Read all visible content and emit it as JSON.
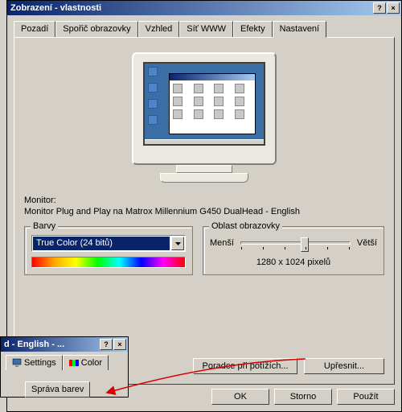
{
  "mainWindow": {
    "title": "Zobrazení - vlastnosti",
    "helpBtn": "?",
    "closeBtn": "×"
  },
  "tabs": [
    "Pozadí",
    "Spořič obrazovky",
    "Vzhled",
    "Síť WWW",
    "Efekty",
    "Nastavení"
  ],
  "activeTabIndex": 5,
  "monitor": {
    "label": "Monitor:",
    "value": "Monitor Plug and Play na Matrox Millennium G450 DualHead - English"
  },
  "colors": {
    "groupTitle": "Barvy",
    "selected": "True Color (24 bitů)"
  },
  "area": {
    "groupTitle": "Oblast obrazovky",
    "lessLabel": "Menší",
    "moreLabel": "Větší",
    "resolution": "1280 x 1024 pixelů"
  },
  "buttons": {
    "troubleshoot": "Poradce při potížích...",
    "advanced": "Upřesnit...",
    "ok": "OK",
    "cancel": "Storno",
    "apply": "Použít"
  },
  "secWindow": {
    "title": "d - English - ...",
    "helpBtn": "?",
    "closeBtn": "×",
    "tabSettings": "Settings",
    "tabColor": "Color",
    "tabColorMgmt": "Správa barev"
  }
}
